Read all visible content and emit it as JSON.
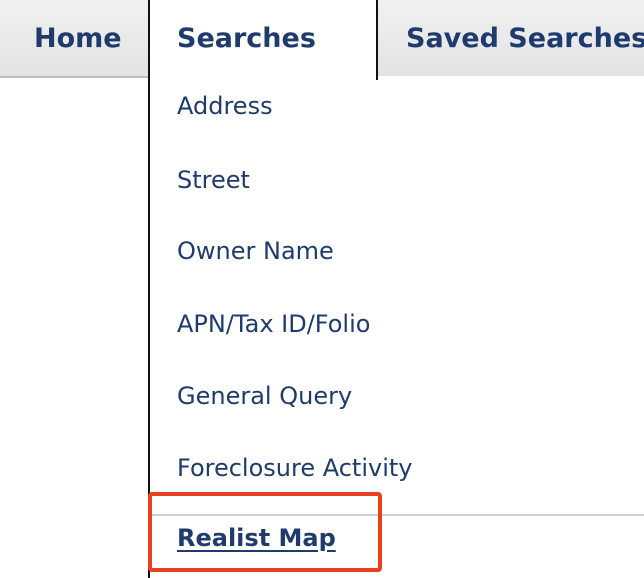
{
  "tabs": {
    "home_label": "Home",
    "searches_label": "Searches",
    "saved_label": "Saved Searches"
  },
  "menu": {
    "items": [
      {
        "label": "Address"
      },
      {
        "label": "Street"
      },
      {
        "label": "Owner Name"
      },
      {
        "label": "APN/Tax ID/Folio"
      },
      {
        "label": "General Query"
      },
      {
        "label": "Foreclosure Activity"
      },
      {
        "label": "Realist Map"
      }
    ]
  },
  "colors": {
    "link": "#1f3b6e",
    "highlight": "#e8411f"
  }
}
